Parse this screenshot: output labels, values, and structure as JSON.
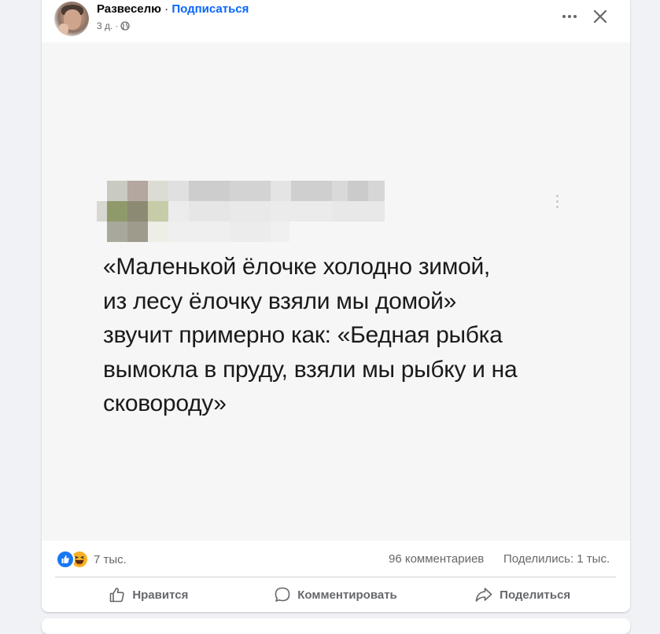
{
  "post": {
    "author": "Развеселю",
    "separator": "·",
    "follow_label": "Подписаться",
    "time": "3 д.",
    "meta_separator": "·",
    "privacy_icon": "globe-icon",
    "more_icon": "more-horizontal-icon",
    "close_icon": "close-icon"
  },
  "image": {
    "quote_lines": [
      "«Маленькой ёлочке холодно зимой,",
      "из лесу ёлочку взяли мы домой»",
      "звучит примерно как: «Бедная рыбка",
      "вымокла в пруду, взяли мы рыбку и на",
      "сковороду»"
    ],
    "kebab_icon": "more-vertical-icon"
  },
  "stats": {
    "reaction_icons": [
      "like-reaction-icon",
      "haha-reaction-icon"
    ],
    "reactions": "7 тыс.",
    "comments": "96 комментариев",
    "shares": "Поделились: 1 тыс."
  },
  "actions": {
    "like": "Нравится",
    "comment": "Комментировать",
    "share": "Поделиться"
  },
  "colors": {
    "accent": "#0866ff",
    "secondary_text": "#65676b",
    "background": "#f0f2f5"
  }
}
